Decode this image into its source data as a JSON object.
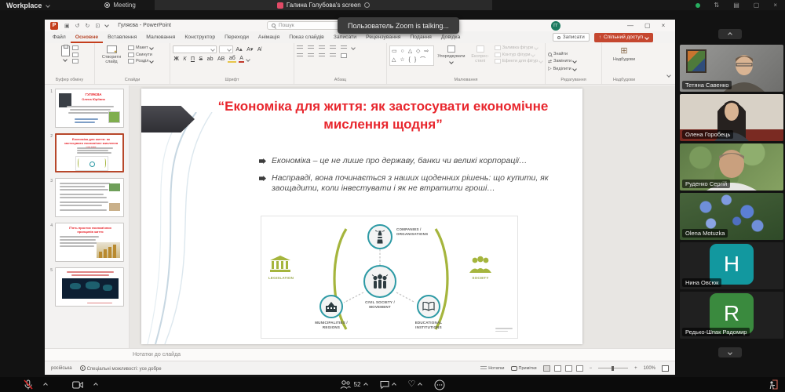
{
  "colors": {
    "slide_title_red": "#e8262d",
    "diagram_teal": "#2d9aa5",
    "diagram_olive": "#a5b53d",
    "share_button_red": "#c5472f",
    "active_tab_underline": "#c43e1c"
  },
  "window": {
    "topbar": {
      "workspace": "Workplace",
      "tab_meeting": "Meeting",
      "tab_screen": "Галина Голубова's screen"
    },
    "toast": "Пользователь Zoom is talking...",
    "toolbar": {
      "participants_count": "52"
    }
  },
  "powerpoint": {
    "title": "Гуляєва - PowerPoint",
    "search": "Пошук",
    "avatar_initials": "ГГ",
    "record_label": "Записати",
    "share_label": "Спільний доступ",
    "tabs": [
      "Файл",
      "Основне",
      "Вставлення",
      "Малювання",
      "Конструктор",
      "Переходи",
      "Анімація",
      "Показ слайдів",
      "Записати",
      "Рецензування",
      "Подання",
      "Довідка"
    ],
    "ribbon": {
      "new_slide": "Створити слайд",
      "layout": "Макет",
      "reset": "Скинути",
      "section": "Розділ",
      "arrange": "Упорядкувати",
      "quick_styles": "Експрес-стилі",
      "shape_fill": "Заливка фігури",
      "shape_outline": "Контур фігури",
      "shape_effects": "Ефекти для фігур",
      "find": "Знайти",
      "replace": "Замінити",
      "select": "Виділити",
      "addins": "Надбудови",
      "groups": {
        "clipboard": "Буфер обміну",
        "slides": "Слайди",
        "font": "Шрифт",
        "paragraph": "Абзац",
        "drawing": "Малювання",
        "editing": "Редагування",
        "addins": "Надбудови"
      }
    },
    "notes_placeholder": "Нотатки до слайда",
    "status": {
      "language": "російська",
      "accessibility": "Спеціальні можливості: усе добре",
      "notes": "Нотатки",
      "comments": "Примітки",
      "zoom": "100%"
    }
  },
  "slide": {
    "title": "“Економіка для життя: як застосувати економічне мислення щодня”",
    "bullets": [
      "Економіка – це не лише про державу, банки чи великі корпорації…",
      "Насправді, вона починається з наших щоденних рішень: що купити, як заощадити, коли інвестувати і як не втратити гроші…"
    ],
    "diagram": {
      "left": "LEGISLATION",
      "right": "SOCIETY",
      "top": "COMPANIES / ORGANISATIONS",
      "center": "CIVIL SOCIETY / MOVEMENT",
      "bottom_left": "MUNICIPALITIES / REGIONS",
      "bottom_right": "EDUCATIONAL INSTITUTIONS"
    }
  },
  "thumbnails": [
    {
      "number": "1",
      "title": "ГУЛЯЄВА",
      "subtitle": "Олена Юріївна"
    },
    {
      "number": "2",
      "title": "Економіка для життя: як застосувати економічне мислення щодня"
    },
    {
      "number": "3"
    },
    {
      "number": "4",
      "title": "П'ять простих економічних принципів життя"
    },
    {
      "number": "5"
    }
  ],
  "participants": [
    {
      "name": "Тетяна Савенко"
    },
    {
      "name": "Олена Горобець"
    },
    {
      "name": "Руденко Сергій"
    },
    {
      "name": "Olena Motuzka"
    },
    {
      "name": "Нина Овсюк",
      "initial": "H",
      "color": "#12989f"
    },
    {
      "name": "Редько-Шпак Радомир",
      "initial": "R",
      "color": "#3a8a3e"
    }
  ]
}
